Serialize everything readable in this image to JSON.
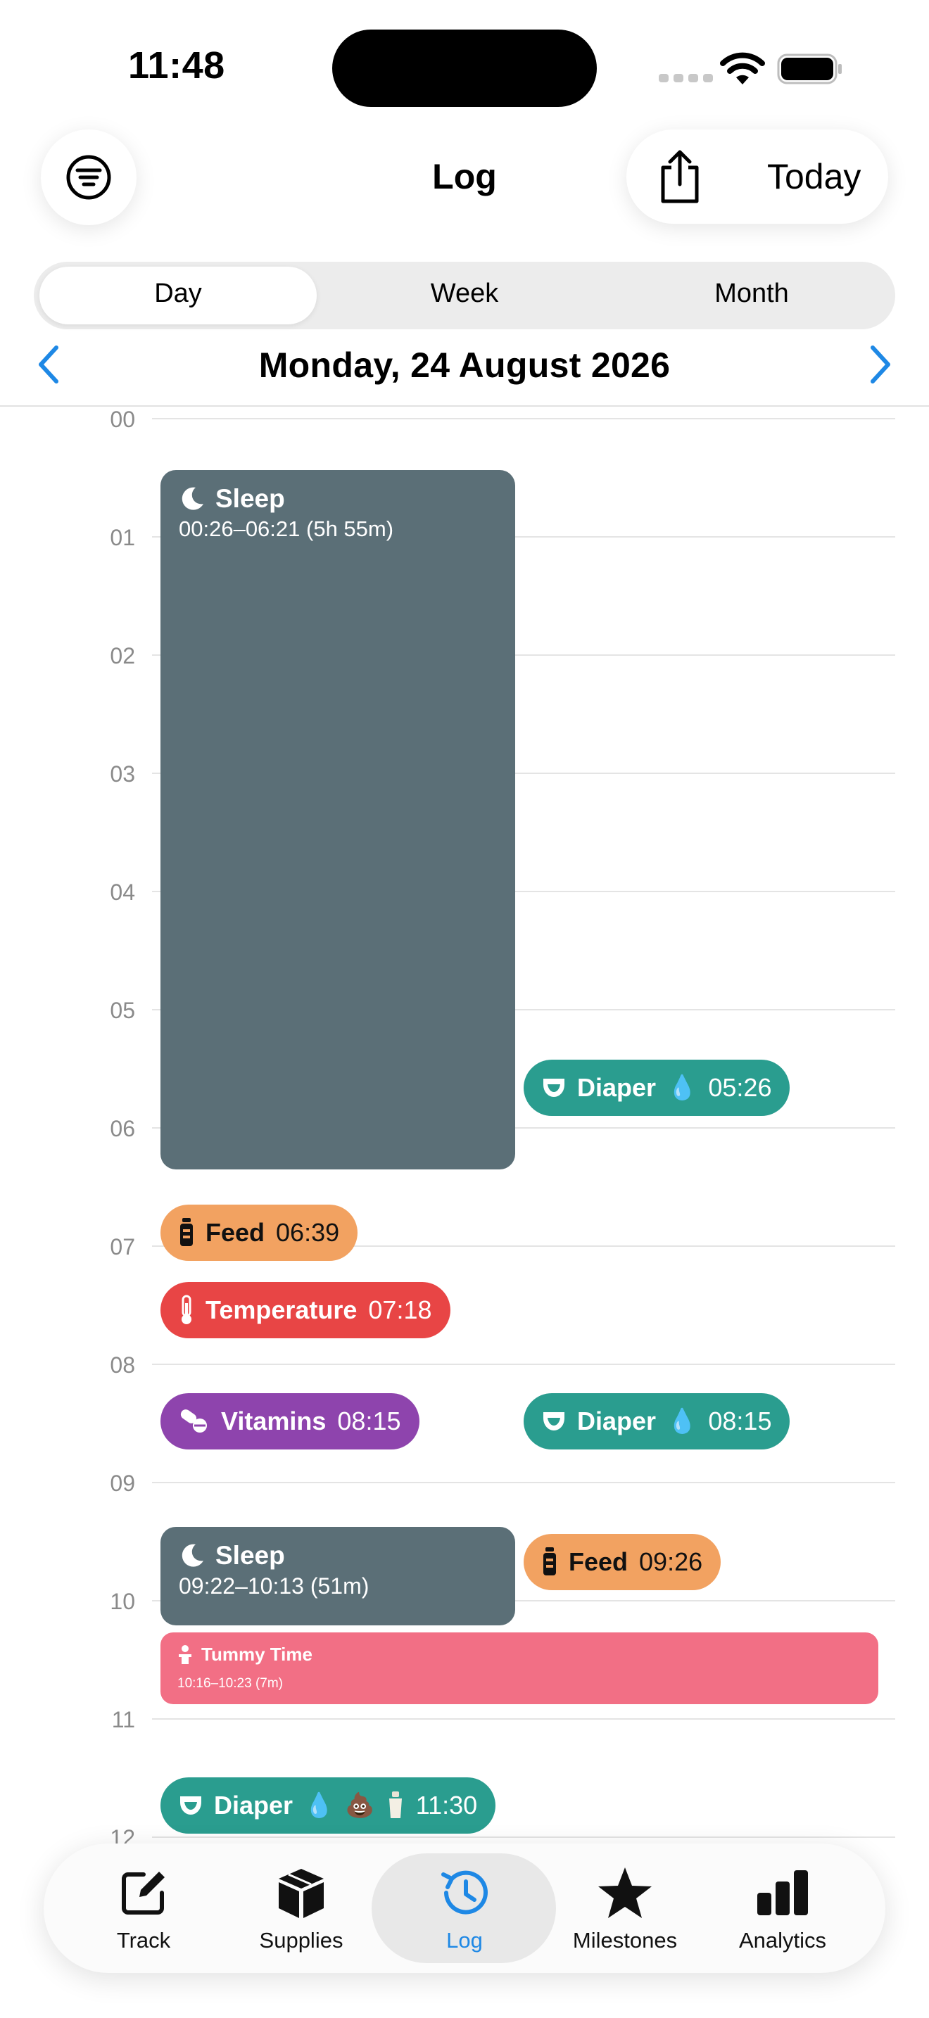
{
  "status_bar": {
    "time": "11:48"
  },
  "header": {
    "title": "Log",
    "today_label": "Today"
  },
  "segments": [
    "Day",
    "Week",
    "Month"
  ],
  "active_segment": "Day",
  "date_label": "Monday, 24 August 2026",
  "hours": [
    "00",
    "01",
    "02",
    "03",
    "04",
    "05",
    "06",
    "07",
    "08",
    "09",
    "10",
    "11",
    "12"
  ],
  "events": {
    "sleep1": {
      "title": "Sleep",
      "range": "00:26–06:21 (5h 55m)"
    },
    "diaper1": {
      "title": "Diaper",
      "time": "05:26"
    },
    "feed1": {
      "title": "Feed",
      "time": "06:39"
    },
    "temperature": {
      "title": "Temperature",
      "time": "07:18"
    },
    "vitamins": {
      "title": "Vitamins",
      "time": "08:15"
    },
    "diaper2": {
      "title": "Diaper",
      "time": "08:15"
    },
    "sleep2": {
      "title": "Sleep",
      "range": "09:22–10:13 (51m)"
    },
    "feed2": {
      "title": "Feed",
      "time": "09:26"
    },
    "tummy": {
      "title": "Tummy Time",
      "range": "10:16–10:23 (7m)"
    },
    "diaper3": {
      "title": "Diaper",
      "time": "11:30"
    }
  },
  "tabs": [
    {
      "label": "Track",
      "icon": "compose-icon"
    },
    {
      "label": "Supplies",
      "icon": "box-icon"
    },
    {
      "label": "Log",
      "icon": "history-icon"
    },
    {
      "label": "Milestones",
      "icon": "star-icon"
    },
    {
      "label": "Analytics",
      "icon": "bar-chart-icon"
    }
  ],
  "active_tab": "Log",
  "colors": {
    "sleep": "#5b6f77",
    "diaper": "#2a9d8f",
    "feed": "#f2a261",
    "temperature": "#e84545",
    "vitamins": "#8e44ad",
    "tummy": "#f26f85",
    "accent": "#1e88e5"
  }
}
